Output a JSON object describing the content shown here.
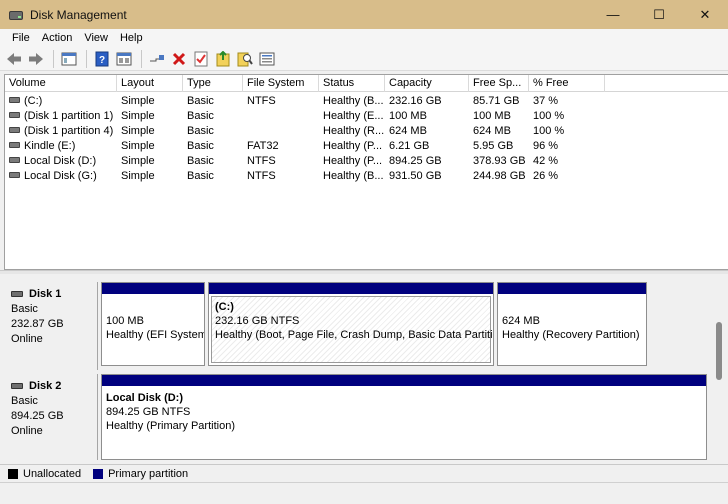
{
  "window": {
    "title": "Disk Management",
    "minimize": "—",
    "maximize": "☐",
    "close": "✕"
  },
  "menu": {
    "file": "File",
    "action": "Action",
    "view": "View",
    "help": "Help"
  },
  "columns": [
    "Volume",
    "Layout",
    "Type",
    "File System",
    "Status",
    "Capacity",
    "Free Sp...",
    "% Free"
  ],
  "volumes": [
    {
      "volume": "(C:)",
      "layout": "Simple",
      "type": "Basic",
      "fs": "NTFS",
      "status": "Healthy (B...",
      "capacity": "232.16 GB",
      "free": "85.71 GB",
      "pct": "37 %"
    },
    {
      "volume": "(Disk 1 partition 1)",
      "layout": "Simple",
      "type": "Basic",
      "fs": "",
      "status": "Healthy (E...",
      "capacity": "100 MB",
      "free": "100 MB",
      "pct": "100 %"
    },
    {
      "volume": "(Disk 1 partition 4)",
      "layout": "Simple",
      "type": "Basic",
      "fs": "",
      "status": "Healthy (R...",
      "capacity": "624 MB",
      "free": "624 MB",
      "pct": "100 %"
    },
    {
      "volume": "Kindle (E:)",
      "layout": "Simple",
      "type": "Basic",
      "fs": "FAT32",
      "status": "Healthy (P...",
      "capacity": "6.21 GB",
      "free": "5.95 GB",
      "pct": "96 %"
    },
    {
      "volume": "Local Disk (D:)",
      "layout": "Simple",
      "type": "Basic",
      "fs": "NTFS",
      "status": "Healthy (P...",
      "capacity": "894.25 GB",
      "free": "378.93 GB",
      "pct": "42 %"
    },
    {
      "volume": "Local Disk (G:)",
      "layout": "Simple",
      "type": "Basic",
      "fs": "NTFS",
      "status": "Healthy (B...",
      "capacity": "931.50 GB",
      "free": "244.98 GB",
      "pct": "26 %"
    }
  ],
  "disks": [
    {
      "name": "Disk 1",
      "type": "Basic",
      "size": "232.87 GB",
      "state": "Online",
      "partitions": [
        {
          "title": "",
          "size": "100 MB",
          "status": "Healthy (EFI System"
        },
        {
          "title": "(C:)",
          "size": "232.16 GB NTFS",
          "status": "Healthy (Boot, Page File, Crash Dump, Basic Data Partition)"
        },
        {
          "title": "",
          "size": "624 MB",
          "status": "Healthy (Recovery Partition)"
        }
      ]
    },
    {
      "name": "Disk 2",
      "type": "Basic",
      "size": "894.25 GB",
      "state": "Online",
      "partitions": [
        {
          "title": "Local Disk  (D:)",
          "size": "894.25 GB NTFS",
          "status": "Healthy (Primary Partition)"
        }
      ]
    }
  ],
  "legend": [
    {
      "label": "Unallocated",
      "color": "#000000"
    },
    {
      "label": "Primary partition",
      "color": "#00007e"
    }
  ],
  "icons": [
    "back-icon",
    "forward-icon",
    "console-tree-icon",
    "help-icon",
    "properties-icon",
    "connect-icon",
    "delete-icon",
    "checklist-icon",
    "export-icon",
    "search-icon",
    "view-icon"
  ]
}
